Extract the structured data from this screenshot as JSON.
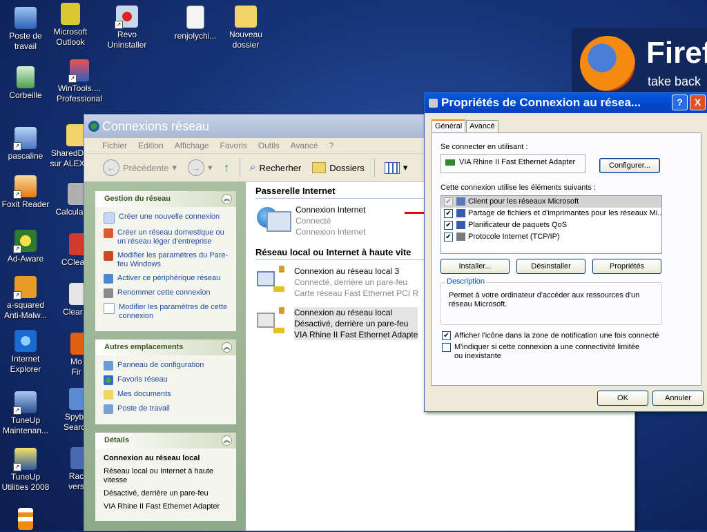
{
  "desktop": {
    "icons": [
      {
        "label": "Poste de travail"
      },
      {
        "label": "Microsoft Outlook"
      },
      {
        "label": "Revo Uninstaller"
      },
      {
        "label": "renjolychi..."
      },
      {
        "label": "Nouveau dossier"
      },
      {
        "label": "Corbeille"
      },
      {
        "label": "WinTools.... Professional"
      },
      {
        "label": "pascaline"
      },
      {
        "label": "SharedD sur ALEX"
      },
      {
        "label": "Foxit Reader"
      },
      {
        "label": "Calcula"
      },
      {
        "label": "Ad-Aware"
      },
      {
        "label": "CClea"
      },
      {
        "label": "a-squared Anti-Malw..."
      },
      {
        "label": "Clear"
      },
      {
        "label": "Internet Explorer"
      },
      {
        "label": "Mo Fir"
      },
      {
        "label": "TuneUp Maintenan..."
      },
      {
        "label": "Spyb Searc"
      },
      {
        "label": "TuneUp Utilities 2008"
      },
      {
        "label": "Rac vers"
      }
    ],
    "banner": {
      "brand": "Firef",
      "tagline": "take back"
    }
  },
  "explorer": {
    "title": "Connexions réseau",
    "menu": [
      "Fichier",
      "Edition",
      "Affichage",
      "Favoris",
      "Outils",
      "Avancé",
      "?"
    ],
    "toolbar": {
      "back": "Précédente",
      "search": "Recherher",
      "folders": "Dossiers"
    },
    "tasks": {
      "title": "Gestion du réseau",
      "links": [
        "Créer une nouvelle connexion",
        "Créer un réseau domestique ou un réseau léger d'entreprise",
        "Modifier les paramètres du Pare-feu Windows",
        "Activer ce périphérique réseau",
        "Renommer cette connexion",
        "Modifier les paramètres de cette connexion"
      ]
    },
    "places": {
      "title": "Autres emplacements",
      "links": [
        "Panneau de configuration",
        "Favoris réseau",
        "Mes documents",
        "Poste de travail"
      ]
    },
    "details": {
      "title": "Détails",
      "name": "Connexion au réseau local",
      "lines": [
        "Réseau local ou Internet à haute vitesse",
        "Désactivé, derrière un pare-feu",
        "VIA Rhine II Fast Ethernet Adapter"
      ]
    },
    "groups": [
      {
        "title": "Passerelle Internet",
        "items": [
          {
            "name": "Connexion Internet",
            "status": "Connecté",
            "device": "Connexion Internet"
          }
        ]
      },
      {
        "title": "Réseau local ou Internet à haute vite",
        "items": [
          {
            "name": "Connexion au réseau local 3",
            "status": "Connecté, derrière un pare-feu",
            "device": "Carte réseau Fast Ethernet PCI R"
          },
          {
            "name": "Connexion au réseau local",
            "status": "Désactivé, derrière un pare-feu",
            "device": "VIA Rhine II Fast Ethernet Adapte"
          }
        ]
      }
    ]
  },
  "dialog": {
    "title": "Propriétés de Connexion au résea...",
    "help": "?",
    "close": "X",
    "tabs": [
      "Général",
      "Avancé"
    ],
    "connect_using_label": "Se connecter en utilisant :",
    "adapter": "VIA Rhine II Fast Ethernet Adapter",
    "configure": "Configurer...",
    "components_label": "Cette connexion utilise les éléments suivants :",
    "components": [
      {
        "label": "Client pour les réseaux Microsoft",
        "checked": "✔"
      },
      {
        "label": "Partage de fichiers et d'imprimantes pour les réseaux Mi...",
        "checked": "✔"
      },
      {
        "label": "Planificateur de paquets QoS",
        "checked": "✔"
      },
      {
        "label": "Protocole Internet (TCP/IP)",
        "checked": "✔"
      }
    ],
    "install": "Installer...",
    "uninstall": "Désinstaller",
    "properties": "Propriétés",
    "description_title": "Description",
    "description": "Permet à votre ordinateur d'accéder aux ressources d'un réseau Microsoft.",
    "show_icon": "Afficher l'icône dans la zone de notification une fois connecté",
    "show_icon_check": "✔",
    "notify": "M'indiquer si cette connexion a une connectivité limitée ou inexistante",
    "ok": "OK",
    "cancel": "Annuler"
  }
}
